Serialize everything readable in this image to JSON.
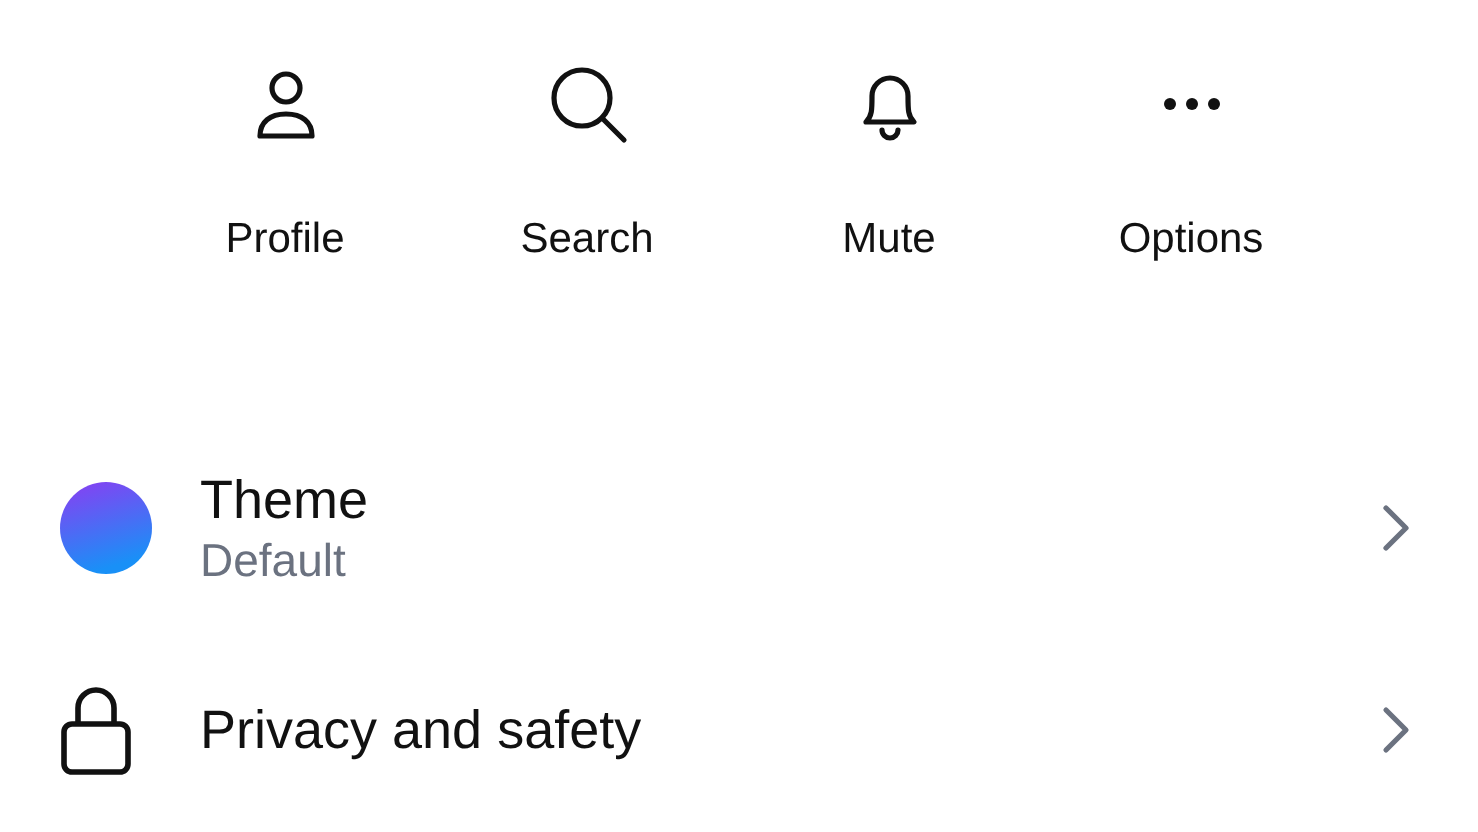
{
  "actions": [
    {
      "kind": "person",
      "label": "Profile"
    },
    {
      "kind": "search",
      "label": "Search"
    },
    {
      "kind": "bell",
      "label": "Mute"
    },
    {
      "kind": "more",
      "label": "Options"
    }
  ],
  "rows": [
    {
      "kind": "theme",
      "title": "Theme",
      "subtitle": "Default"
    },
    {
      "kind": "lock",
      "title": "Privacy and safety"
    }
  ]
}
